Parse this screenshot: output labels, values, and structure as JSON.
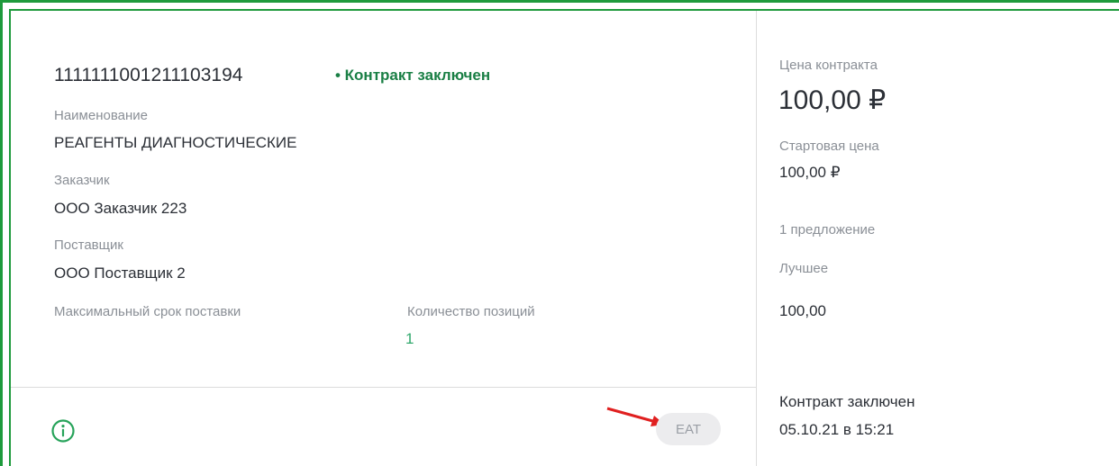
{
  "card": {
    "number": "1111111001211103194",
    "status": "• Контракт заключен",
    "name_label": "Наименование",
    "name_value": "РЕАГЕНТЫ ДИАГНОСТИЧЕСКИЕ",
    "customer_label": "Заказчик",
    "customer_value": "ООО Заказчик 223",
    "supplier_label": "Поставщик",
    "supplier_value": "ООО Поставщик 2",
    "delivery_label": "Максимальный срок поставки",
    "positions_label": "Количество позиций",
    "positions_value": "1"
  },
  "footer": {
    "info_icon": "info-circle-icon",
    "chip_label": "ЕАТ"
  },
  "side": {
    "price_label": "Цена контракта",
    "price_value": "100,00 ₽",
    "start_label": "Стартовая цена",
    "start_value": "100,00 ₽",
    "offers": "1 предложение",
    "best_label": "Лучшее",
    "best_value": "100,00",
    "contract_status": "Контракт заключен",
    "contract_date": "05.10.21 в 15:21"
  },
  "colors": {
    "frame": "#1e9a3c",
    "status_green": "#1a7f45",
    "accent_green": "#2fa86b",
    "annotation_arrow": "#e02020"
  }
}
